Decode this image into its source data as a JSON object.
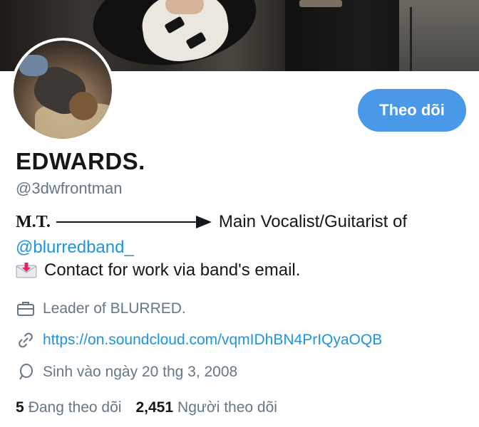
{
  "profile": {
    "display_name": "EDWARDS.",
    "handle": "@3dwfrontman",
    "follow_button_label": "Theo dõi"
  },
  "bio": {
    "line1_prefix": "M.T.",
    "line1_text": "Main Vocalist/Guitarist of",
    "mention": "@blurredband_",
    "line2_text": "Contact for work via band's email.",
    "line2_icon": "incoming-envelope-icon"
  },
  "meta": {
    "work": {
      "icon": "briefcase-icon",
      "text": "Leader of BLURRED."
    },
    "link": {
      "icon": "link-icon",
      "text": "https://on.soundcloud.com/vqmIDhBN4PrIQyaOQB"
    },
    "birthday": {
      "icon": "balloon-icon",
      "text": "Sinh vào ngày 20 thg 3, 2008"
    }
  },
  "stats": {
    "following_count": "5",
    "following_label": "Đang theo dõi",
    "followers_count": "2,451",
    "followers_label": "Người theo dõi"
  },
  "colors": {
    "accent": "#4a99e9",
    "link": "#1b95e0",
    "muted": "#657786",
    "text": "#14171a"
  }
}
